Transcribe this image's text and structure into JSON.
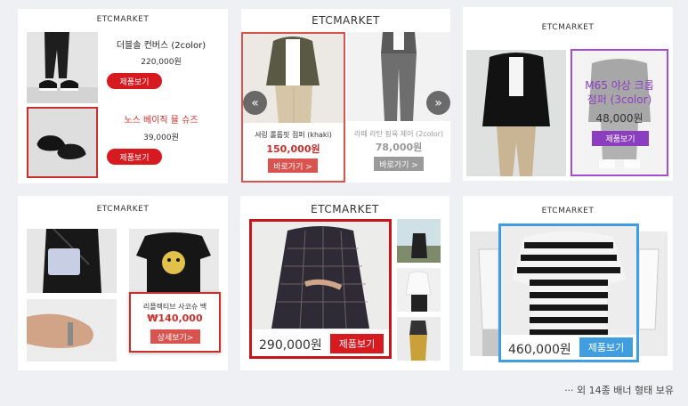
{
  "banners": [
    {
      "brand": "ETCMARKET",
      "products": [
        {
          "name": "더블솔 컨버스 (2color)",
          "price": "220,000원",
          "button": "제품보기"
        },
        {
          "name": "노스 베이직 뮬 슈즈",
          "price": "39,000원",
          "button": "제품보기"
        }
      ]
    },
    {
      "brand": "ETCMARKET",
      "slides": [
        {
          "name": "셔링 롤룹핏 점퍼 (khaki)",
          "price": "150,000원",
          "button": "바로가기 >"
        },
        {
          "name": "라떼 라탄 핑육 제어 (2color)",
          "price": "78,000원",
          "button": "바로가기 >"
        }
      ],
      "prev_label": "«",
      "next_label": "»"
    },
    {
      "brand": "ETCMARKET",
      "product": {
        "name_line1": "M65 야상 크롭",
        "name_line2": "점퍼 (3color)",
        "price": "48,000원",
        "button": "제품보기"
      }
    },
    {
      "brand": "ETCMARKET",
      "product": {
        "name": "리플렉티브 사코슈 백",
        "price": "₩140,000",
        "button": "상세보기>"
      }
    },
    {
      "brand": "ETCMARKET",
      "product": {
        "price": "290,000원",
        "button": "제품보기"
      }
    },
    {
      "brand": "ETCMARKET",
      "product": {
        "price": "460,000원",
        "button": "제품보기"
      }
    }
  ],
  "footer_note": "··· 외 14종 배너 형태 보유",
  "colors": {
    "accent_red": "#d71920",
    "purple": "#8b3fc0",
    "blue": "#3f9de0",
    "gray": "#9a9a9a"
  }
}
